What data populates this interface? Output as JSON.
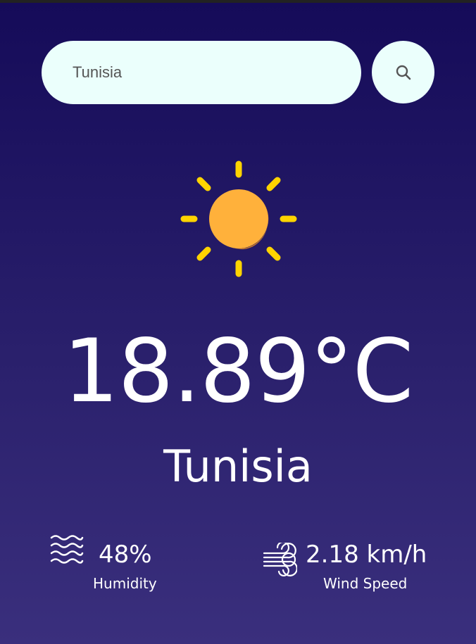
{
  "search": {
    "value": "Tunisia",
    "button_icon": "search-icon"
  },
  "weather": {
    "icon": "sun-icon",
    "temperature": "18.89°C",
    "city": "Tunisia"
  },
  "details": {
    "humidity": {
      "icon": "humidity-waves-icon",
      "value": "48%",
      "label": "Humidity"
    },
    "wind": {
      "icon": "wind-icon",
      "value": "2.18 km/h",
      "label": "Wind Speed"
    }
  },
  "colors": {
    "background_top": "#150b59",
    "background_bottom": "#3a2f7d",
    "input_background": "#ebfffc",
    "sun_body": "#ffb13b",
    "sun_rays": "#ffd400",
    "text": "#ffffff"
  }
}
